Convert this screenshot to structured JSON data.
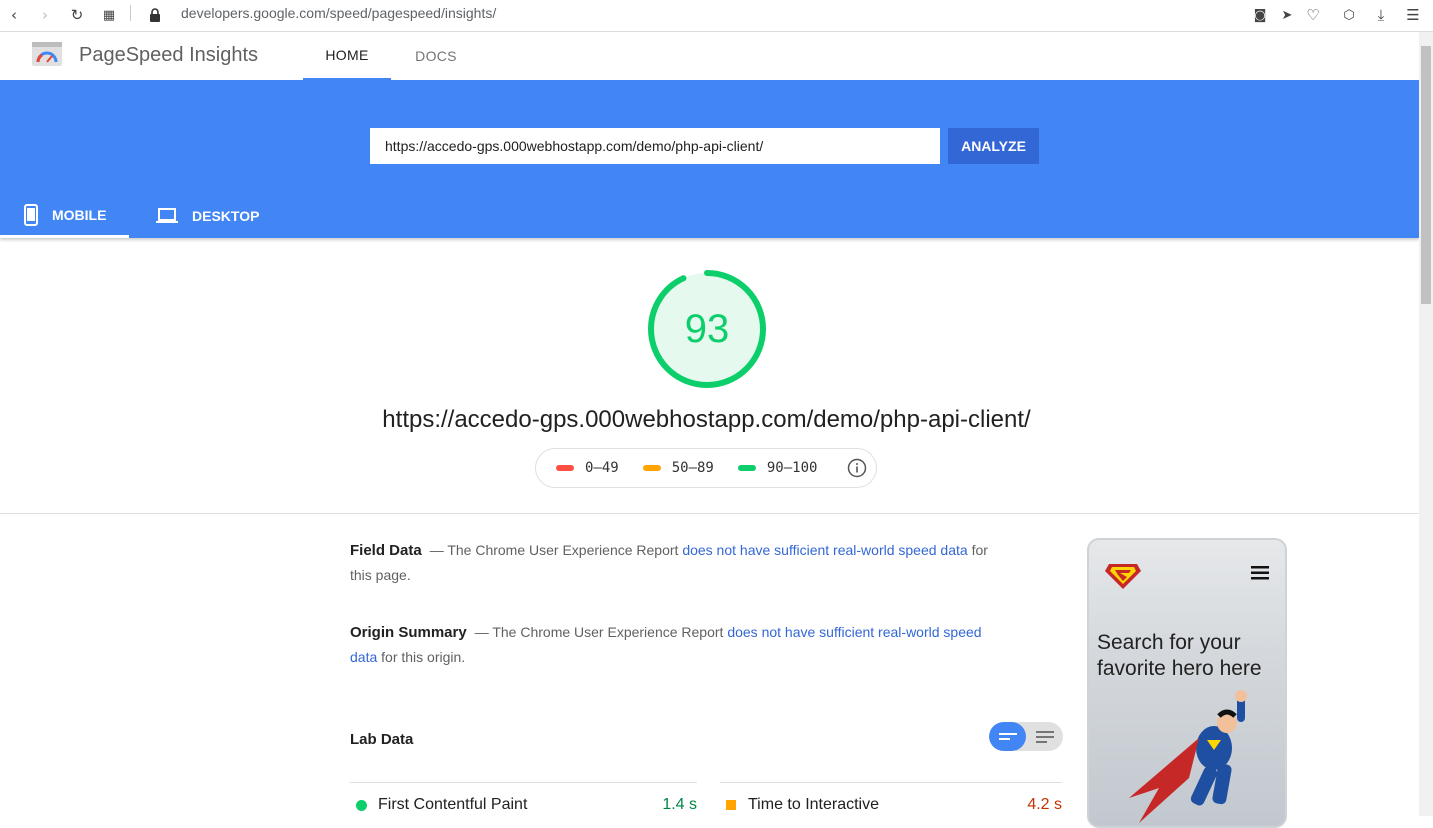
{
  "browser": {
    "url": "developers.google.com/speed/pagespeed/insights/",
    "icons": [
      "back-icon",
      "forward-icon",
      "reload-icon",
      "grid-icon",
      "lock-icon",
      "camera-icon",
      "send-icon",
      "heart-icon",
      "cube-icon",
      "download-icon",
      "menu-icon"
    ]
  },
  "header": {
    "app_title": "PageSpeed Insights",
    "tabs": [
      {
        "label": "HOME"
      },
      {
        "label": "DOCS"
      }
    ]
  },
  "hero": {
    "input_value": "https://accedo-gps.000webhostapp.com/demo/php-api-client/",
    "analyze_label": "ANALYZE",
    "device_tabs": [
      {
        "label": "MOBILE"
      },
      {
        "label": "DESKTOP"
      }
    ]
  },
  "summary": {
    "score": "93",
    "score_fraction": 0.93,
    "url": "https://accedo-gps.000webhostapp.com/demo/php-api-client/",
    "legend": [
      {
        "label": "0–49",
        "color": "#ff4e42"
      },
      {
        "label": "50–89",
        "color": "#ffa400"
      },
      {
        "label": "90–100",
        "color": "#0cce6b"
      }
    ]
  },
  "field_data": {
    "title": "Field Data",
    "pre": "— The Chrome User Experience Report ",
    "link": "does not have sufficient real-world speed data",
    "post": " for this page."
  },
  "origin_summary": {
    "title": "Origin Summary",
    "pre": "— The Chrome User Experience Report ",
    "link": "does not have sufficient real-world speed data",
    "post": " for this origin."
  },
  "lab_data": {
    "title": "Lab Data",
    "metrics": [
      {
        "label": "First Contentful Paint",
        "value": "1.4 s",
        "color": "#018642"
      },
      {
        "label": "Time to Interactive",
        "value": "4.2 s",
        "color": "#c33300"
      }
    ]
  },
  "preview": {
    "text": "Search for your favorite hero here"
  }
}
